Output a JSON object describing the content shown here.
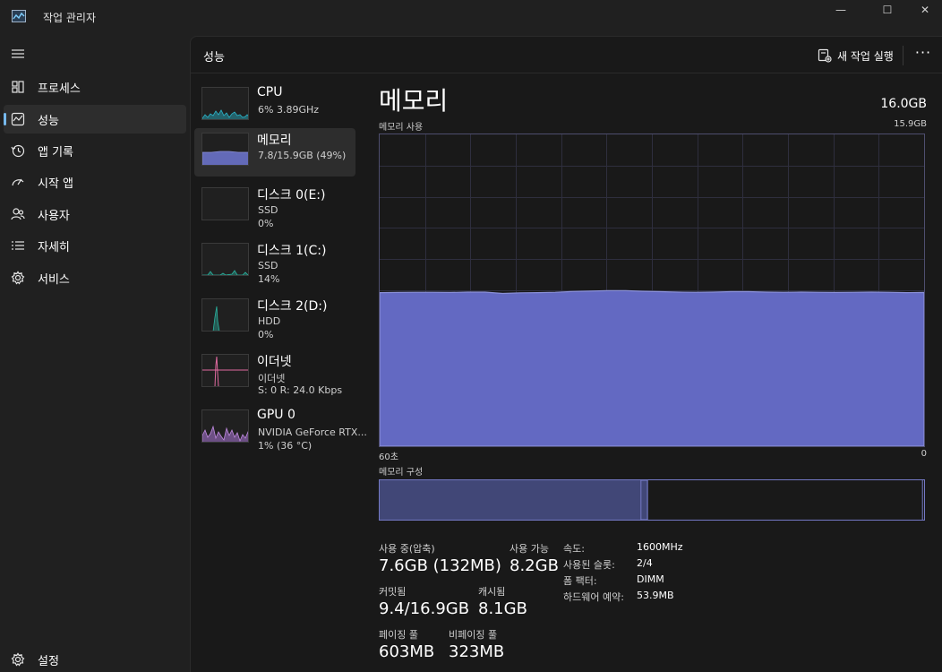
{
  "window": {
    "title": "작업 관리자",
    "controls": {
      "minimize": "—",
      "maximize": "☐",
      "close": "✕"
    }
  },
  "nav": {
    "items": [
      {
        "label": "프로세스",
        "icon": "processes-icon"
      },
      {
        "label": "성능",
        "icon": "performance-icon",
        "active": true
      },
      {
        "label": "앱 기록",
        "icon": "app-history-icon"
      },
      {
        "label": "시작 앱",
        "icon": "startup-apps-icon"
      },
      {
        "label": "사용자",
        "icon": "users-icon"
      },
      {
        "label": "자세히",
        "icon": "details-icon"
      },
      {
        "label": "서비스",
        "icon": "services-icon"
      }
    ],
    "settings": {
      "label": "설정",
      "icon": "settings-icon"
    }
  },
  "header": {
    "title": "성능",
    "new_task": "새 작업 실행",
    "more": "···"
  },
  "resources": [
    {
      "name": "CPU",
      "sub1": "6%  3.89GHz",
      "sub2": "",
      "color": "#2ab3c8"
    },
    {
      "name": "메모리",
      "sub1": "7.8/15.9GB (49%)",
      "sub2": "",
      "color": "#6a72c9",
      "active": true
    },
    {
      "name": "디스크 0(E:)",
      "sub1": "SSD",
      "sub2": "0%",
      "color": "#2ab3a0"
    },
    {
      "name": "디스크 1(C:)",
      "sub1": "SSD",
      "sub2": "14%",
      "color": "#2ab3a0"
    },
    {
      "name": "디스크 2(D:)",
      "sub1": "HDD",
      "sub2": "0%",
      "color": "#2ab3a0"
    },
    {
      "name": "이더넷",
      "sub1": "이더넷",
      "sub2": "S: 0  R: 24.0 Kbps",
      "color": "#e06aa0"
    },
    {
      "name": "GPU 0",
      "sub1": "NVIDIA GeForce RTX...",
      "sub2": "1%  (36 °C)",
      "color": "#a070c8"
    }
  ],
  "detail": {
    "title": "메모리",
    "total": "16.0GB",
    "usage_label": "메모리 사용",
    "usage_max": "15.9GB",
    "axis_left": "60초",
    "axis_right": "0",
    "composition_label": "메모리 구성",
    "composition": {
      "in_use_fraction": 0.48,
      "modified_fraction": 0.012,
      "standby_fraction": 0.505
    },
    "graph": {
      "max_gb": 15.9,
      "usage_gb": [
        7.83,
        7.84,
        7.85,
        7.85,
        7.84,
        7.86,
        7.86,
        7.79,
        7.82,
        7.83,
        7.85,
        7.89,
        7.91,
        7.93,
        7.93,
        7.9,
        7.88,
        7.86,
        7.85,
        7.86,
        7.88,
        7.88,
        7.86,
        7.85,
        7.86,
        7.85,
        7.84,
        7.85,
        7.86,
        7.85,
        7.83,
        7.84
      ]
    },
    "stats": {
      "in_use_label": "사용 중(압축)",
      "in_use_value": "7.6GB (132MB)",
      "available_label": "사용 가능",
      "available_value": "8.2GB",
      "committed_label": "커밋됨",
      "committed_value": "9.4/16.9GB",
      "cached_label": "캐시됨",
      "cached_value": "8.1GB",
      "paged_label": "페이징 풀",
      "paged_value": "603MB",
      "nonpaged_label": "비페이징 풀",
      "nonpaged_value": "323MB"
    },
    "specs": [
      {
        "key": "속도:",
        "value": "1600MHz"
      },
      {
        "key": "사용된 슬롯:",
        "value": "2/4"
      },
      {
        "key": "폼 팩터:",
        "value": "DIMM"
      },
      {
        "key": "하드웨어 예약:",
        "value": "53.9MB"
      }
    ]
  }
}
